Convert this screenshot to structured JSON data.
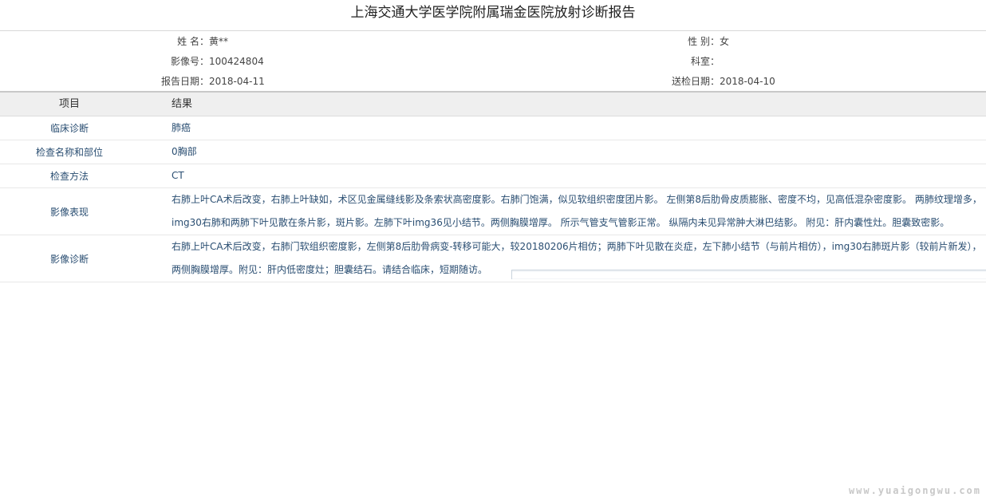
{
  "report": {
    "title": "上海交通大学医学院附属瑞金医院放射诊断报告"
  },
  "patient": {
    "name_label": "姓 名：",
    "name_value": "黄**",
    "gender_label": "性 别：",
    "gender_value": "女",
    "image_no_label": "影像号：",
    "image_no_value": "100424804",
    "department_label": "科室：",
    "department_value": "",
    "report_date_label": "报告日期：",
    "report_date_value": "2018-04-11",
    "submit_date_label": "送检日期：",
    "submit_date_value": "2018-04-10"
  },
  "table": {
    "header_item": "项目",
    "header_result": "结果",
    "rows": [
      {
        "item": "临床诊断",
        "result": "肺癌"
      },
      {
        "item": "检查名称和部位",
        "result": "0胸部"
      },
      {
        "item": "检查方法",
        "result": "CT"
      },
      {
        "item": "影像表现",
        "line1": "右肺上叶CA术后改变，右肺上叶缺如，术区见金属缝线影及条索状高密度影。右肺门饱满，似见软组织密度团片影。 左侧第8后肋骨皮质膨胀、密度不均，见高低混杂密度影。 两肺纹理增多，",
        "line2": "img30右肺和两肺下叶见散在条片影，斑片影。左肺下叶img36见小结节。两侧胸膜增厚。 所示气管支气管影正常。 纵隔内未见异常肿大淋巴结影。 附见：肝内囊性灶。胆囊致密影。"
      },
      {
        "item": "影像诊断",
        "line1": "右肺上叶CA术后改变，右肺门软组织密度影，左侧第8后肋骨病变-转移可能大，较20180206片相仿；两肺下叶见散在炎症，左下肺小结节（与前片相仿），img30右肺斑片影（较前片新发），",
        "line2": "两侧胸膜增厚。附见：肝内低密度灶；胆囊结石。请结合临床，短期随访。"
      }
    ]
  },
  "watermark": {
    "text": "www.yuaigongwu.com"
  }
}
